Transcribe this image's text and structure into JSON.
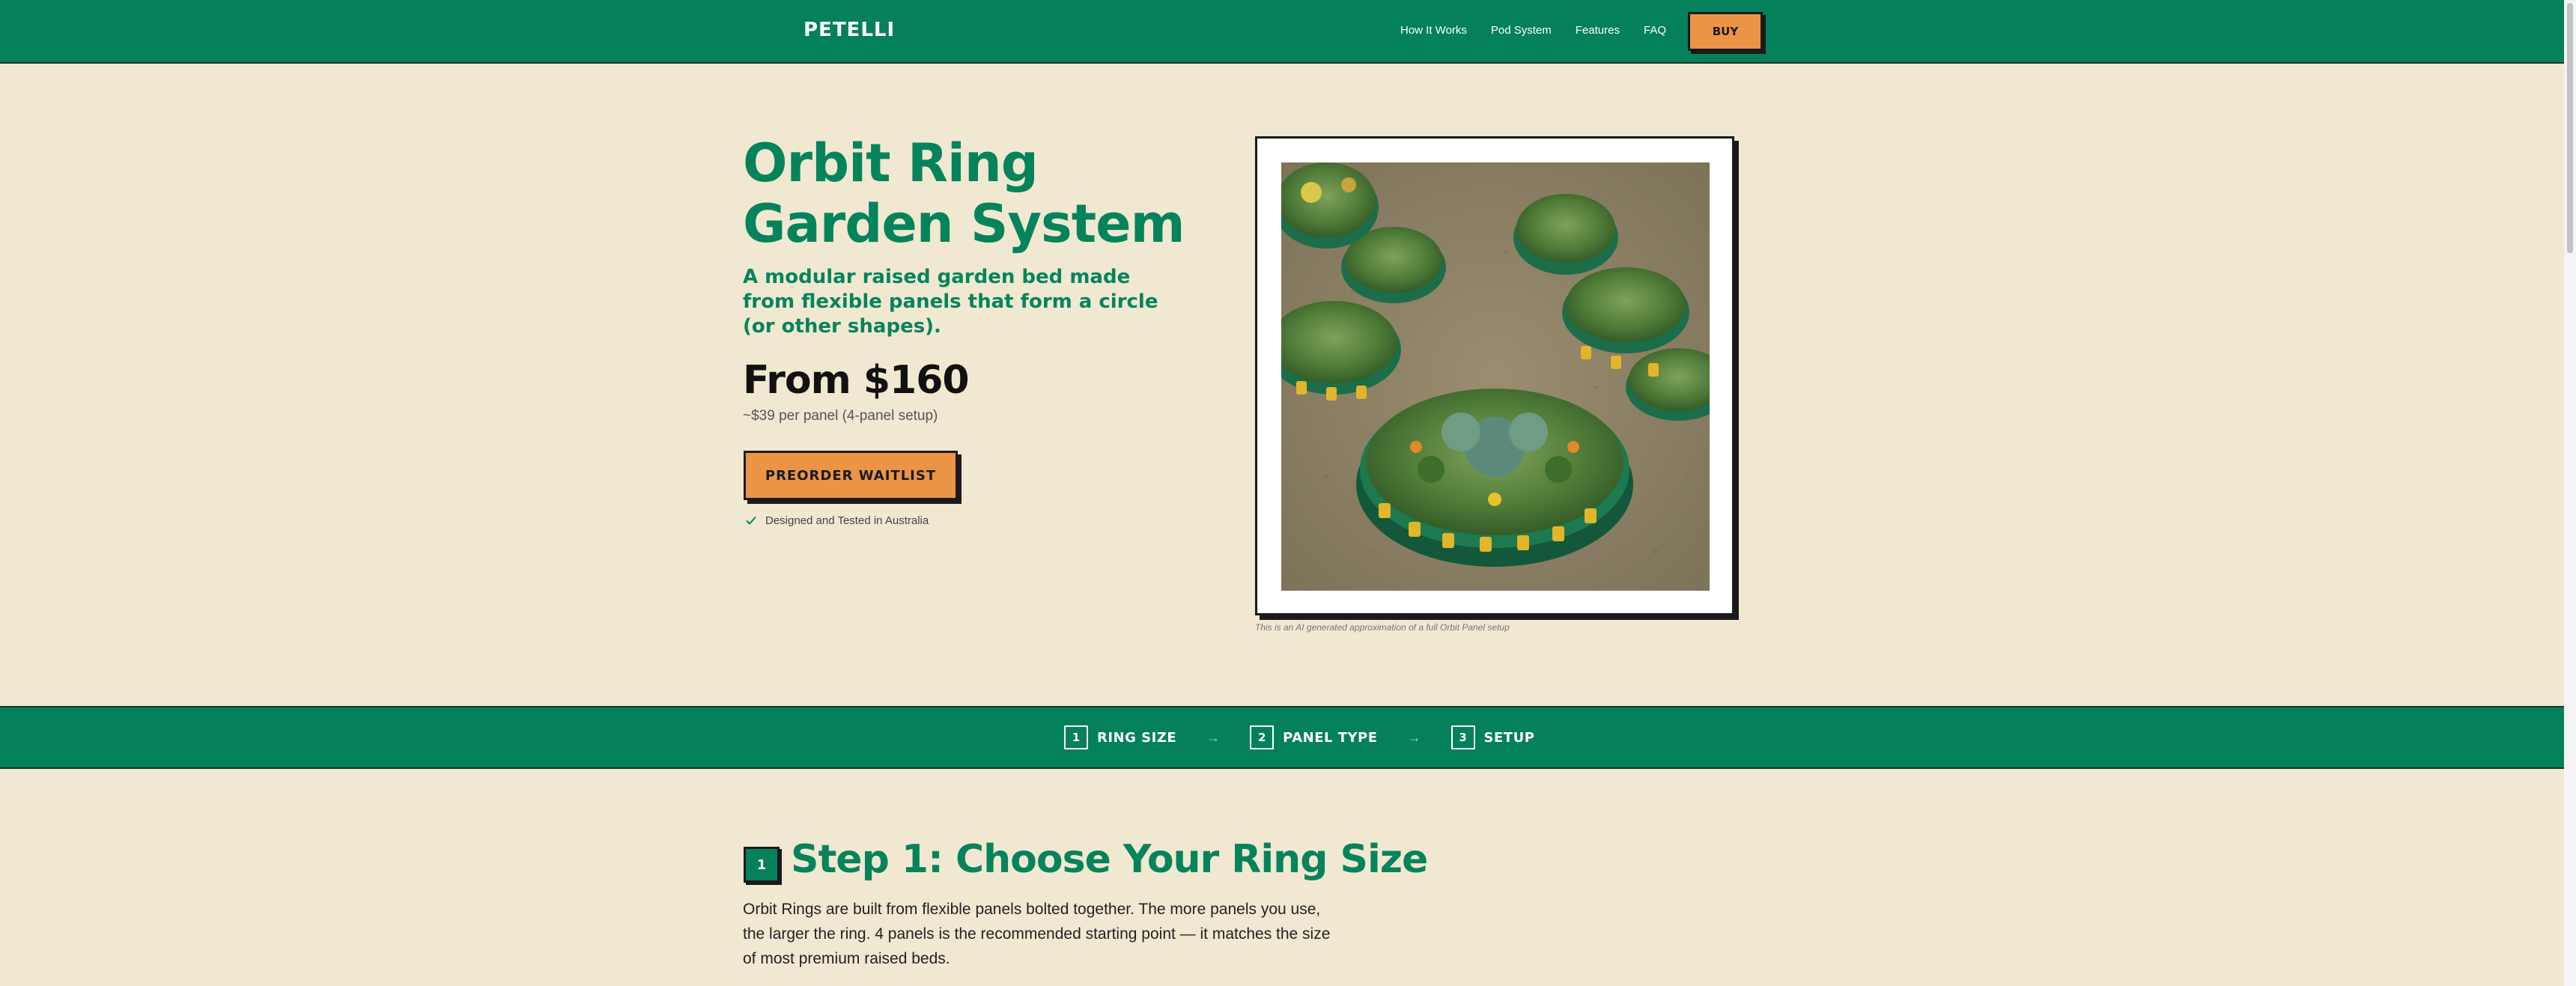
{
  "nav": {
    "logo": "PETELLI",
    "links": [
      "How It Works",
      "Pod System",
      "Features",
      "FAQ"
    ],
    "buy_label": "BUY"
  },
  "hero": {
    "title": "Orbit Ring Garden System",
    "subtitle": "A modular raised garden bed made from flexible panels that form a circle (or other shapes).",
    "price": "From $160",
    "price_note": "~$39 per panel (4-panel setup)",
    "cta_label": "PREORDER WAITLIST",
    "tested_note": "Designed and Tested in Australia",
    "image_caption": "This is an AI generated approximation of a full Orbit Panel setup"
  },
  "step_bar": {
    "steps": [
      {
        "num": "1",
        "label": "RING SIZE"
      },
      {
        "num": "2",
        "label": "PANEL TYPE"
      },
      {
        "num": "3",
        "label": "SETUP"
      }
    ],
    "arrow": "→"
  },
  "step1": {
    "num": "1",
    "title": "Step 1: Choose Your Ring Size",
    "body": "Orbit Rings are built from flexible panels bolted together. The more panels you use, the larger the ring. 4 panels is the recommended starting point — it matches the size of most premium raised beds."
  },
  "colors": {
    "brand_green": "#04805a",
    "accent_orange": "#ec9446",
    "background": "#f1e8d2",
    "ink": "#1a1a1a"
  }
}
